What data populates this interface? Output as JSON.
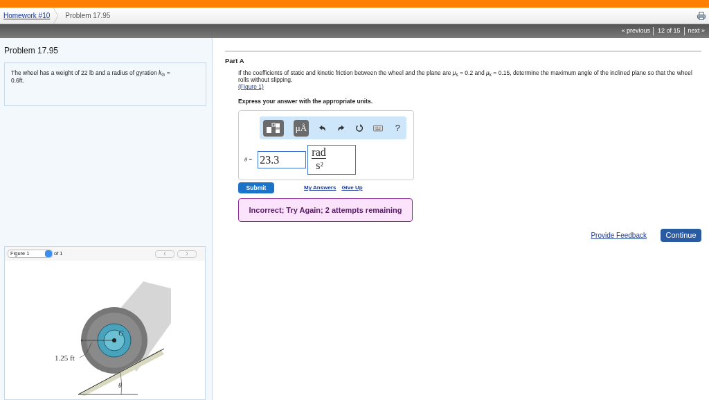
{
  "breadcrumb": {
    "link": "Homework #10",
    "current": "Problem 17.95"
  },
  "nav": {
    "previous": "« previous",
    "position": "12 of 15",
    "next": "next »"
  },
  "problem": {
    "title": "Problem 17.95",
    "statement": "The wheel has a weight of 22 lb and a radius of gyration *k*$_{G}$ = 0.6ft."
  },
  "figure_panel": {
    "select": "Figure 1",
    "of": "of 1",
    "labels": {
      "radius": "1.25 ft",
      "center": "G",
      "angle": "θ"
    }
  },
  "part": {
    "title": "Part A",
    "question": "If the coefficients of static and kinetic friction between the wheel and the plane are *μ*$_{s}$ = 0.2 and *μ*$_{k}$ = 0.15, determine the maximum angle of the inclined plane so that the wheel rolls without slipping.",
    "figure_link": "(Figure 1)",
    "instruction": "Express your answer with the appropriate units."
  },
  "toolbar": [
    {
      "kind": "templates"
    },
    {
      "kind": "units",
      "label": "μÅ"
    },
    {
      "kind": "undo"
    },
    {
      "kind": "redo"
    },
    {
      "kind": "reset"
    },
    {
      "kind": "keyboard"
    },
    {
      "kind": "help",
      "label": "?"
    }
  ],
  "answer": {
    "label": "θ =",
    "value": "23.3",
    "unit_numerator": "rad",
    "unit_denominator": "s",
    "unit_power": "2"
  },
  "actions": {
    "submit": "Submit",
    "my_answers": "My Answers",
    "give_up": "Give Up"
  },
  "feedback": "Incorrect; Try Again; 2 attempts remaining",
  "footer": {
    "provide_feedback": "Provide Feedback",
    "continue": "Continue"
  }
}
